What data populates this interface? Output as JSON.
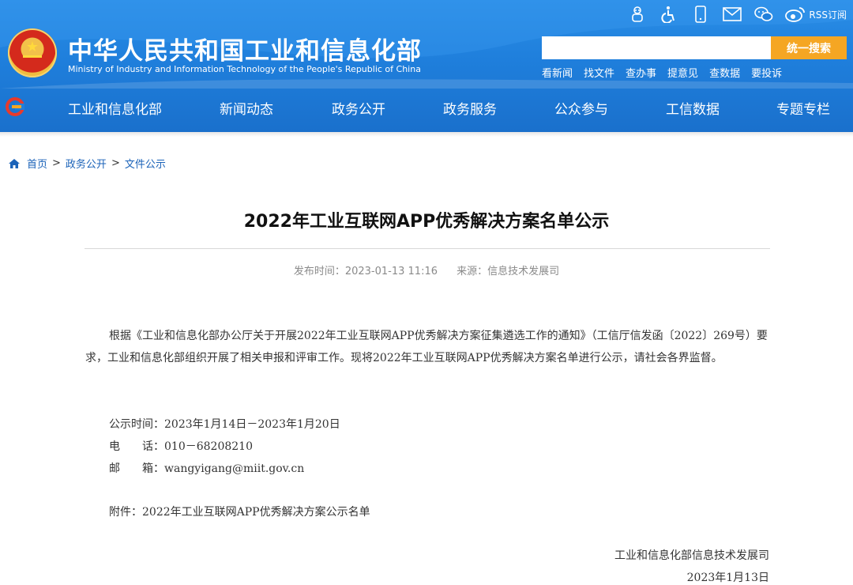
{
  "header": {
    "title": "中华人民共和国工业和信息化部",
    "subtitle": "Ministry of Industry and Information Technology of the People's Republic of China",
    "emblem_icon": "national-emblem-icon",
    "background_color": "#1f7fdc",
    "accent_color": "#f5a623",
    "top_icons": [
      "robot-icon",
      "accessibility-icon",
      "mobile-icon",
      "mail-icon",
      "wechat-icon",
      "weibo-icon"
    ],
    "rss_label": "RSS订阅",
    "search": {
      "placeholder": "",
      "button_label": "统一搜索"
    },
    "quick_links": [
      "看新闻",
      "找文件",
      "查办事",
      "提意见",
      "查数据",
      "要投诉"
    ]
  },
  "nav": {
    "items": [
      "工业和信息化部",
      "新闻动态",
      "政务公开",
      "政务服务",
      "公众参与",
      "工信数据",
      "专题专栏"
    ]
  },
  "breadcrumb": {
    "items": [
      "首页",
      "政务公开",
      "文件公示"
    ],
    "separator": ">"
  },
  "article": {
    "title": "2022年工业互联网APP优秀解决方案名单公示",
    "publish_label": "发布时间：2023-01-13 11:16",
    "source_label": "来源：信息技术发展司",
    "body": "根据《工业和信息化部办公厅关于开展2022年工业互联网APP优秀解决方案征集遴选工作的通知》（工信厅信发函〔2022〕269号）要求，工业和信息化部组织开展了相关申报和评审工作。现将2022年工业互联网APP优秀解决方案名单进行公示，请社会各界监督。",
    "period": "公示时间：2023年1月14日－2023年1月20日",
    "phone": "电　　话：010－68208210",
    "email": "邮　　箱：wangyigang@miit.gov.cn",
    "attachment": "附件：2022年工业互联网APP优秀解决方案公示名单",
    "signer": "工业和信息化部信息技术发展司",
    "sign_date": "2023年1月13日"
  }
}
